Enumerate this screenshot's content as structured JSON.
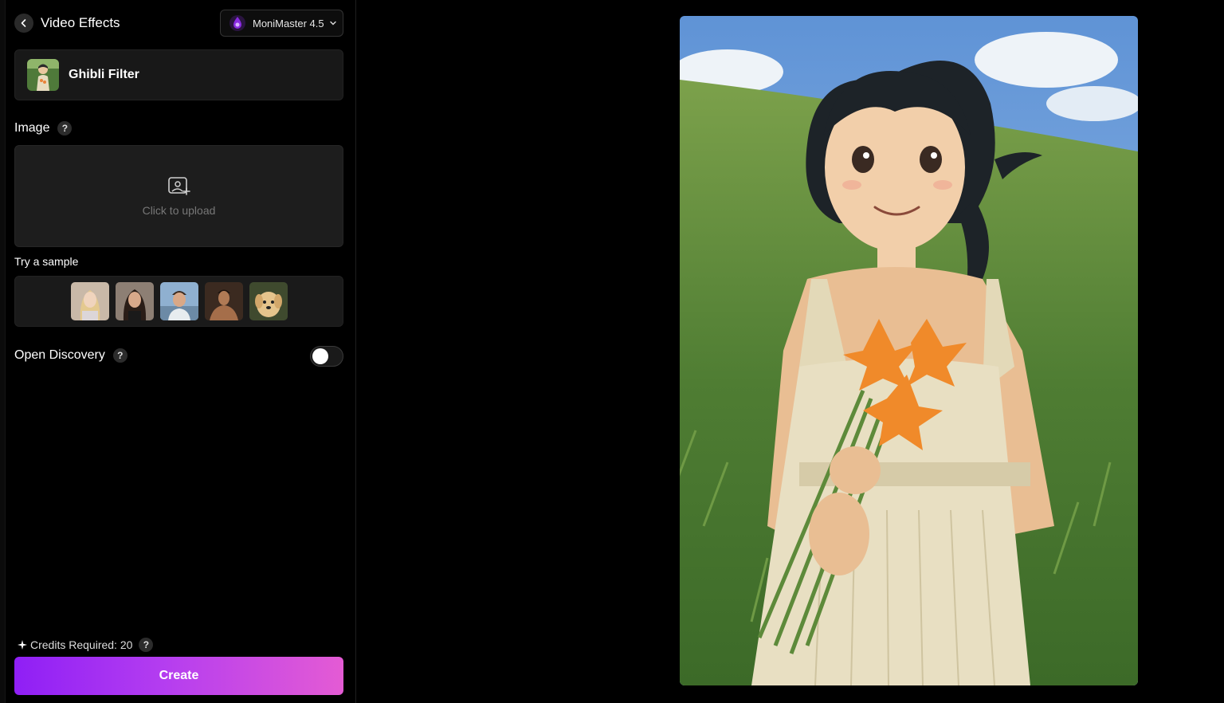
{
  "header": {
    "title": "Video Effects",
    "model_label": "MoniMaster 4.5"
  },
  "effect": {
    "name": "Ghibli Filter"
  },
  "image_section": {
    "label": "Image",
    "help": "?",
    "upload_text": "Click to upload"
  },
  "samples": {
    "label": "Try a sample",
    "items": [
      "sample-woman-blonde",
      "sample-woman-dark-hair",
      "sample-man-outdoor",
      "sample-man-shirtless",
      "sample-puppy"
    ]
  },
  "discovery": {
    "label": "Open Discovery",
    "help": "?",
    "enabled": false
  },
  "footer": {
    "credits_text": "Credits Required: 20",
    "help": "?",
    "create_label": "Create"
  },
  "colors": {
    "accent_start": "#8f1ff5",
    "accent_end": "#e45bd4",
    "background": "#000000",
    "panel": "#1d1d1d"
  }
}
